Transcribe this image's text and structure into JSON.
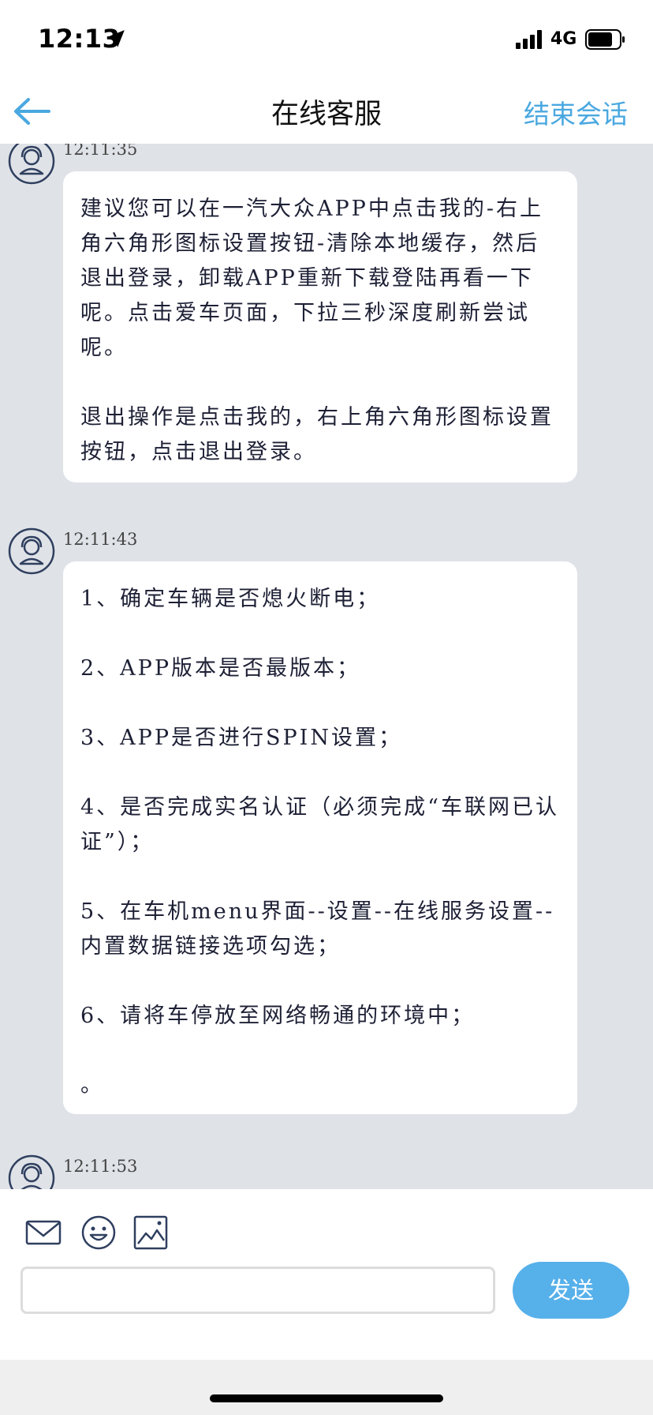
{
  "status_bar": {
    "time": "12:13",
    "network": "4G"
  },
  "header": {
    "title": "在线客服",
    "end_session_label": "结束会话"
  },
  "messages": [
    {
      "time": "12:11:35",
      "paragraphs": [
        "建议您可以在一汽大众APP中点击我的-右上角六角形图标设置按钮-清除本地缓存，然后退出登录，卸载APP重新下载登陆再看一下呢。点击爱车页面，下拉三秒深度刷新尝试呢。",
        "退出操作是点击我的，右上角六角形图标设置按钮，点击退出登录。"
      ]
    },
    {
      "time": "12:11:43",
      "paragraphs": [
        "1、确定车辆是否熄火断电；",
        "2、APP版本是否最版本；",
        "3、APP是否进行SPIN设置；",
        "4、是否完成实名认证（必须完成“车联网已认证”）；",
        "5、在车机menu界面--设置--在线服务设置--内置数据链接选项勾选；",
        "6、请将车停放至网络畅通的环境中；",
        "。"
      ]
    },
    {
      "time": "12:11:53"
    }
  ],
  "input": {
    "placeholder": "",
    "send_label": "发送"
  },
  "icons": [
    "location-arrow-icon",
    "signal-icon",
    "battery-icon",
    "back-arrow-icon",
    "agent-avatar-icon",
    "mail-icon",
    "emoji-icon",
    "image-icon"
  ],
  "colors": {
    "accent": "#4aa8e0",
    "send_button": "#56b0ea",
    "chat_bg": "#dfe2e7",
    "avatar": "#2f3f5f"
  }
}
